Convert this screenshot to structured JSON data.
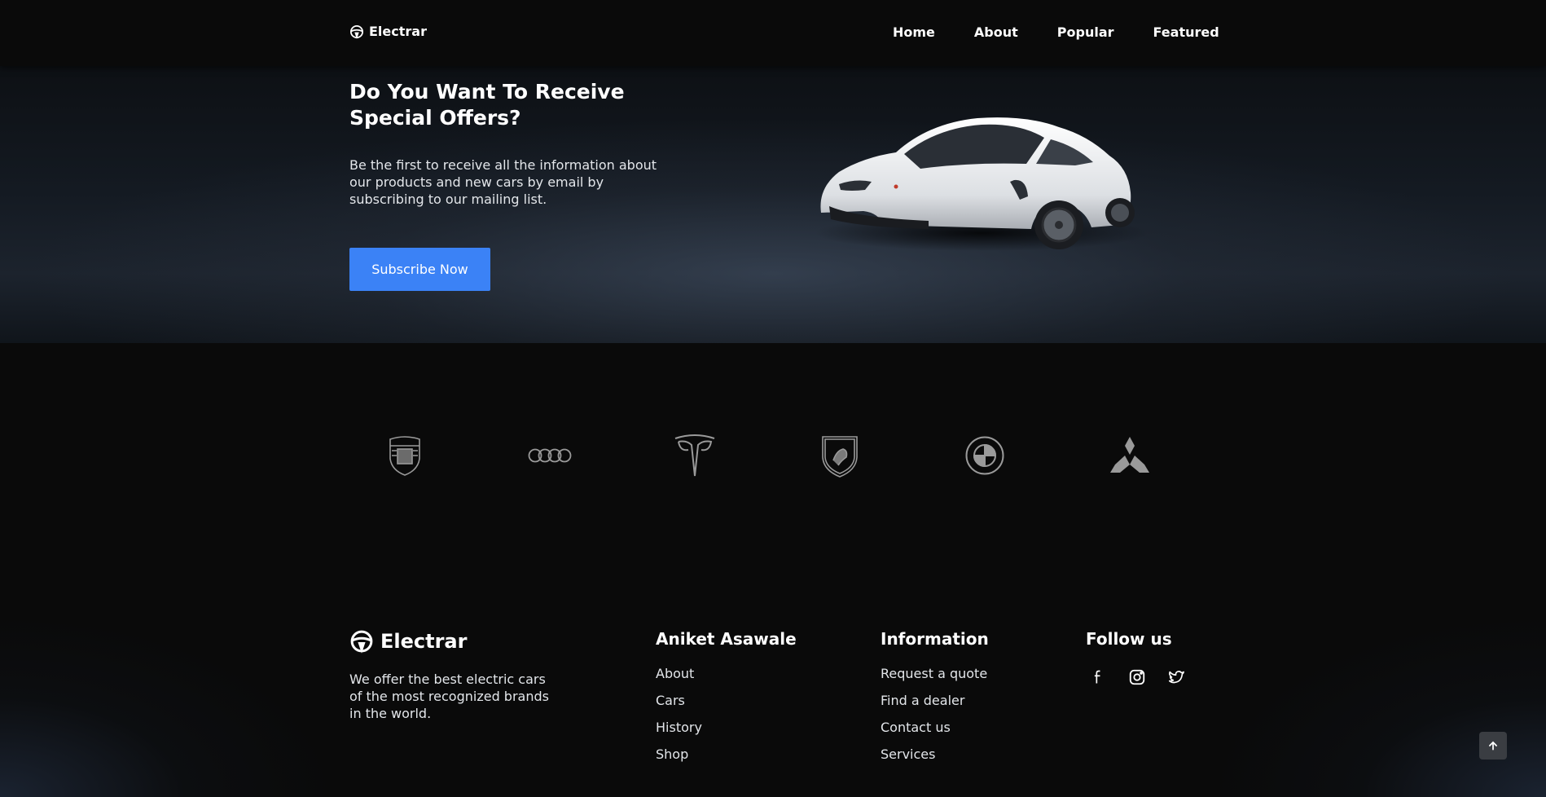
{
  "header": {
    "logo_text": "Electrar",
    "logo_icon": "steering-wheel-icon",
    "nav": [
      {
        "label": "Home"
      },
      {
        "label": "About"
      },
      {
        "label": "Popular"
      },
      {
        "label": "Featured"
      }
    ]
  },
  "hero": {
    "title": "Do You Want To Receive Special Offers?",
    "text": "Be the first to receive all the information about our products and new cars by email by subscribing to our mailing list.",
    "button_label": "Subscribe Now"
  },
  "brands": [
    "porsche-logo",
    "audi-logo",
    "tesla-logo",
    "lamborghini-logo",
    "bmw-logo",
    "mitsubishi-logo"
  ],
  "footer": {
    "logo_text": "Electrar",
    "description": "We offer the best electric cars of the most recognized brands in the world.",
    "columns": [
      {
        "title": "Aniket Asawale",
        "links": [
          "About",
          "Cars",
          "History",
          "Shop"
        ]
      },
      {
        "title": "Information",
        "links": [
          "Request a quote",
          "Find a dealer",
          "Contact us",
          "Services"
        ]
      }
    ],
    "follow_title": "Follow us",
    "social_icons": [
      "facebook-icon",
      "instagram-icon",
      "twitter-icon"
    ]
  },
  "colors": {
    "accent": "#3b82f6",
    "background": "#0a0a0a",
    "text": "#ffffff",
    "brand_logo": "#9a9a9a"
  },
  "scroll_top_icon": "arrow-up-icon"
}
